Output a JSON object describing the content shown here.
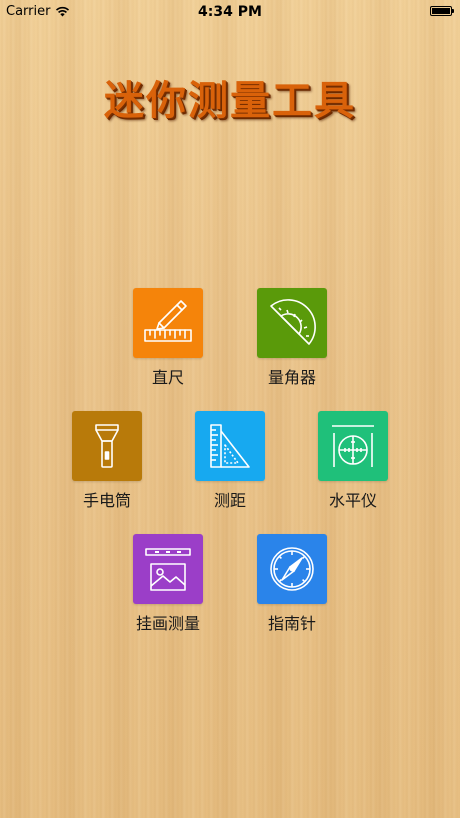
{
  "status_bar": {
    "carrier": "Carrier",
    "time": "4:34 PM",
    "wifi_icon": "wifi-icon",
    "battery_level": 1.0
  },
  "app_title": "迷你测量工具",
  "tools": {
    "ruler": {
      "label": "直尺",
      "color": "#f5840a",
      "icon": "ruler-pencil-icon"
    },
    "protractor": {
      "label": "量角器",
      "color": "#5a9a0a",
      "icon": "protractor-icon"
    },
    "flashlight": {
      "label": "手电筒",
      "color": "#b87a0a",
      "icon": "flashlight-icon"
    },
    "distance": {
      "label": "测距",
      "color": "#17a9f0",
      "icon": "set-square-icon"
    },
    "level": {
      "label": "水平仪",
      "color": "#1fc07a",
      "icon": "level-crosshair-icon"
    },
    "picture": {
      "label": "挂画测量",
      "color": "#9b3ec8",
      "icon": "picture-frame-icon"
    },
    "compass": {
      "label": "指南针",
      "color": "#2a84ea",
      "icon": "compass-icon"
    }
  }
}
